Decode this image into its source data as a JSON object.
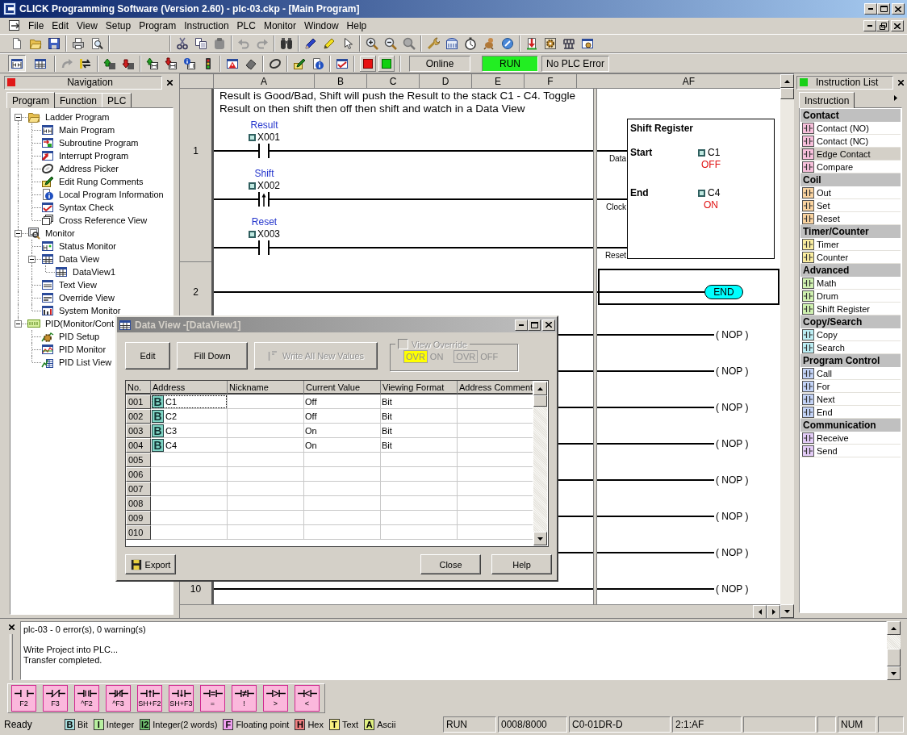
{
  "window": {
    "title": "CLICK Programming Software (Version 2.60) - plc-03.ckp - [Main Program]"
  },
  "menu": [
    "File",
    "Edit",
    "View",
    "Setup",
    "Program",
    "Instruction",
    "PLC",
    "Monitor",
    "Window",
    "Help"
  ],
  "toolbar": {
    "view_toggles": [
      {
        "selected": true
      },
      {
        "selected": false
      }
    ],
    "connection": "Online",
    "run_status": {
      "label": "RUN",
      "on": true
    },
    "error_status": "No PLC Error"
  },
  "navigation": {
    "title": "Navigation",
    "tabs": [
      {
        "label": "Program",
        "selected": true
      },
      {
        "label": "Function",
        "selected": false
      },
      {
        "label": "PLC",
        "selected": false
      }
    ],
    "tree": [
      {
        "label": "Ladder Program",
        "expanded": true,
        "children": [
          {
            "label": "Main Program"
          },
          {
            "label": "Subroutine Program"
          },
          {
            "label": "Interrupt Program"
          },
          {
            "label": "Address Picker"
          },
          {
            "label": "Edit Rung Comments"
          },
          {
            "label": "Local Program Information"
          },
          {
            "label": "Syntax Check"
          },
          {
            "label": "Cross Reference View"
          }
        ]
      },
      {
        "label": "Monitor",
        "expanded": true,
        "children": [
          {
            "label": "Status Monitor"
          },
          {
            "label": "Data View",
            "expanded": true,
            "children": [
              {
                "label": "DataView1"
              }
            ]
          },
          {
            "label": "Text View"
          },
          {
            "label": "Override View"
          },
          {
            "label": "System Monitor"
          }
        ]
      },
      {
        "label": "PID(Monitor/Cont",
        "expanded": true,
        "children": [
          {
            "label": "PID Setup"
          },
          {
            "label": "PID Monitor"
          },
          {
            "label": "PID List View"
          }
        ]
      }
    ]
  },
  "ladder": {
    "columns": [
      "A",
      "B",
      "C",
      "D",
      "E",
      "F",
      "AF"
    ],
    "rungs": [
      {
        "number": "1",
        "selected": false,
        "comment": "Result is Good/Bad, Shift will push the Result to the stack C1 - C4. Toggle Result on then shift then off then shift and watch in a Data View",
        "contacts": [
          {
            "kind": "no",
            "nickname": "Result",
            "address": "X001"
          },
          {
            "kind": "edge",
            "nickname": "Shift",
            "address": "X002"
          },
          {
            "kind": "no",
            "nickname": "Reset",
            "address": "X003"
          }
        ],
        "output": {
          "kind": "shift_register",
          "title": "Shift Register",
          "start_label": "Start",
          "start_address": "C1",
          "start_value": "OFF",
          "end_label": "End",
          "end_address": "C4",
          "end_value": "ON",
          "inputs": [
            "Data",
            "Clock",
            "Reset"
          ]
        }
      },
      {
        "number": "2",
        "selected": true,
        "output": {
          "kind": "end",
          "label": "END"
        }
      },
      {
        "selected": false,
        "output": {
          "kind": "nop",
          "label": "( NOP )"
        }
      },
      {
        "selected": false,
        "output": {
          "kind": "nop",
          "label": "( NOP )"
        }
      },
      {
        "selected": false,
        "output": {
          "kind": "nop",
          "label": "( NOP )"
        }
      },
      {
        "selected": false,
        "output": {
          "kind": "nop",
          "label": "( NOP )"
        }
      },
      {
        "selected": false,
        "output": {
          "kind": "nop",
          "label": "( NOP )"
        }
      },
      {
        "selected": false,
        "output": {
          "kind": "nop",
          "label": "( NOP )"
        }
      },
      {
        "selected": false,
        "output": {
          "kind": "nop",
          "label": "( NOP )"
        }
      },
      {
        "number": "10",
        "selected": false,
        "output": {
          "kind": "nop",
          "label": "( NOP )"
        }
      }
    ]
  },
  "instruction_list": {
    "title": "Instruction List",
    "tabs": [
      {
        "label": "Instruction",
        "selected": true
      }
    ],
    "groups": [
      {
        "label": "Contact",
        "color": "#f8c0dc",
        "items": [
          {
            "label": "Contact (NO)",
            "selected": false
          },
          {
            "label": "Contact (NC)",
            "selected": false
          },
          {
            "label": "Edge Contact",
            "selected": true
          },
          {
            "label": "Compare",
            "selected": false
          }
        ]
      },
      {
        "label": "Coil",
        "color": "#fbd4a0",
        "items": [
          {
            "label": "Out",
            "selected": false
          },
          {
            "label": "Set",
            "selected": false
          },
          {
            "label": "Reset",
            "selected": false
          }
        ]
      },
      {
        "label": "Timer/Counter",
        "color": "#fbeea0",
        "items": [
          {
            "label": "Timer",
            "selected": false
          },
          {
            "label": "Counter",
            "selected": false
          }
        ]
      },
      {
        "label": "Advanced",
        "color": "#d0f2b0",
        "items": [
          {
            "label": "Math",
            "selected": false
          },
          {
            "label": "Drum",
            "selected": false
          },
          {
            "label": "Shift Register",
            "selected": false
          }
        ]
      },
      {
        "label": "Copy/Search",
        "color": "#bceef4",
        "items": [
          {
            "label": "Copy",
            "selected": false
          },
          {
            "label": "Search",
            "selected": false
          }
        ]
      },
      {
        "label": "Program Control",
        "color": "#c4d4f8",
        "items": [
          {
            "label": "Call",
            "selected": false
          },
          {
            "label": "For",
            "selected": false
          },
          {
            "label": "Next",
            "selected": false
          },
          {
            "label": "End",
            "selected": false
          }
        ]
      },
      {
        "label": "Communication",
        "color": "#e4ccf8",
        "items": [
          {
            "label": "Receive",
            "selected": false
          },
          {
            "label": "Send",
            "selected": false
          }
        ]
      }
    ]
  },
  "output": {
    "messages": [
      [
        "plc-03 - 0 error(s), 0 warning(s)"
      ],
      [
        "Write Project into PLC...",
        "Transfer completed."
      ]
    ]
  },
  "function_keys": [
    {
      "kind": "no",
      "label": "F2"
    },
    {
      "kind": "nc",
      "label": "F3"
    },
    {
      "kind": "no_branch",
      "label": "^F2"
    },
    {
      "kind": "nc_branch",
      "label": "^F3"
    },
    {
      "kind": "rise",
      "label": "SH+F2"
    },
    {
      "kind": "fall",
      "label": "SH+F3"
    },
    {
      "kind": "eq",
      "label": "="
    },
    {
      "kind": "ne",
      "label": "!"
    },
    {
      "kind": "gt",
      "label": ">"
    },
    {
      "kind": "lt",
      "label": "<"
    }
  ],
  "status_bar": {
    "state": "Ready",
    "data_types": [
      {
        "badge": "B",
        "label": "Bit",
        "color": "#a8e0e0"
      },
      {
        "badge": "I",
        "label": "Integer",
        "color": "#b8f0a0"
      },
      {
        "badge": "I2",
        "label": "Integer(2 words)",
        "color": "#70c070"
      },
      {
        "badge": "F",
        "label": "Floating point",
        "color": "#f0a0f0"
      },
      {
        "badge": "H",
        "label": "Hex",
        "color": "#f08080"
      },
      {
        "badge": "T",
        "label": "Text",
        "color": "#f8f080"
      },
      {
        "badge": "A",
        "label": "Ascii",
        "color": "#e0f080"
      }
    ],
    "panes": [
      "RUN",
      "0008/8000",
      "C0-01DR-D",
      "2:1:AF"
    ],
    "indicators": [
      "NUM"
    ]
  },
  "data_view": {
    "title": "Data View -[DataView1]",
    "active": false,
    "buttons": [
      {
        "kind": "plain",
        "label": "Edit",
        "disabled": false
      },
      {
        "kind": "plain",
        "label": "Fill Down",
        "disabled": false
      },
      {
        "kind": "write",
        "label": "Write All New Values",
        "disabled": true
      }
    ],
    "view_override": {
      "label": "View Override",
      "checked": false,
      "disabled": true,
      "options": [
        {
          "badge": "OVR",
          "label": "ON",
          "selected": true
        },
        {
          "badge": "OVR",
          "label": "OFF",
          "selected": false
        }
      ]
    },
    "columns": [
      "No.",
      "Address",
      "Nickname",
      "Current Value",
      "Viewing Format",
      "Address Comment"
    ],
    "rows": [
      {
        "no": "001",
        "type": "B",
        "address": "C1",
        "current_value": "Off",
        "viewing_format": "Bit",
        "selected": true
      },
      {
        "no": "002",
        "type": "B",
        "address": "C2",
        "current_value": "Off",
        "viewing_format": "Bit",
        "selected": false
      },
      {
        "no": "003",
        "type": "B",
        "address": "C3",
        "current_value": "On",
        "viewing_format": "Bit",
        "selected": false
      },
      {
        "no": "004",
        "type": "B",
        "address": "C4",
        "current_value": "On",
        "viewing_format": "Bit",
        "selected": false
      },
      {
        "no": "005",
        "selected": false
      },
      {
        "no": "006",
        "selected": false
      },
      {
        "no": "007",
        "selected": false
      },
      {
        "no": "008",
        "selected": false
      },
      {
        "no": "009",
        "selected": false
      },
      {
        "no": "010",
        "selected": false
      }
    ],
    "export_button": {
      "label": "Export"
    },
    "footer_buttons": [
      {
        "label": "Close"
      },
      {
        "label": "Help"
      }
    ]
  }
}
